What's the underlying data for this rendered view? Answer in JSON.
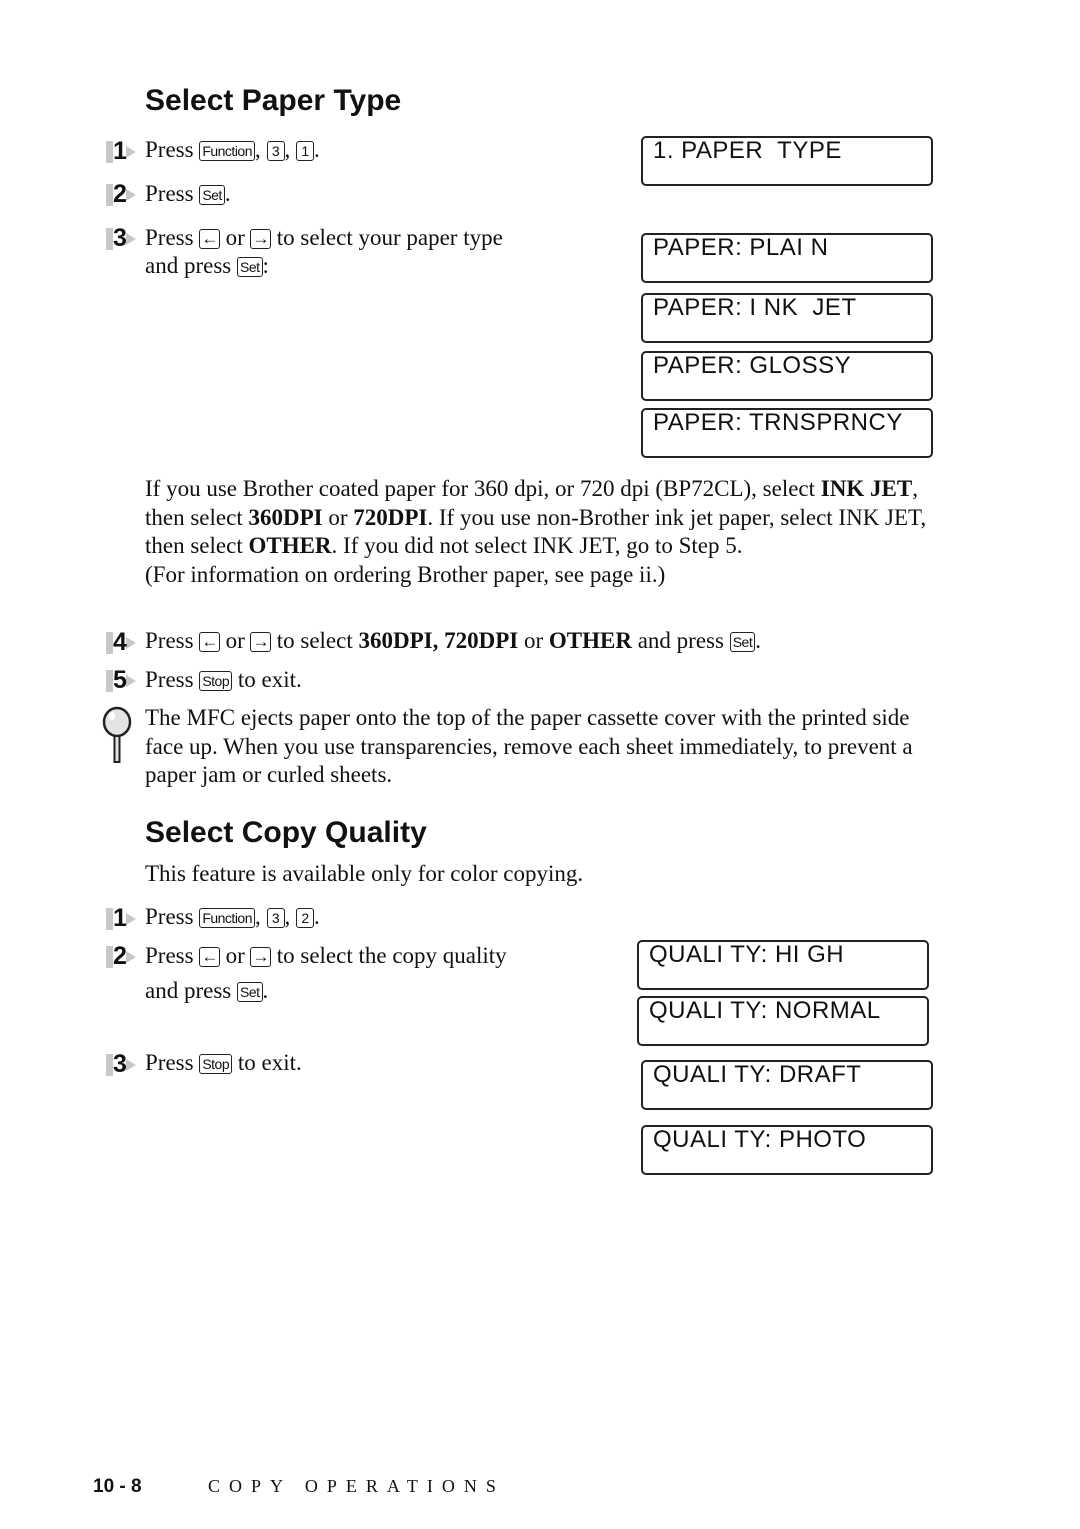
{
  "section1": {
    "title": "Select Paper Type",
    "steps": [
      {
        "num": "1",
        "press": "Press",
        "keys": [
          "Function",
          "3",
          "1"
        ],
        "end": "."
      },
      {
        "num": "2",
        "press": "Press",
        "key": "Set",
        "end": "."
      },
      {
        "num": "3",
        "press": "Press",
        "key_left": "←",
        "or": "or",
        "key_right": "→",
        "text1": "to select your paper type",
        "text2": "and press",
        "key": "Set",
        "end": ":"
      },
      {
        "num": "4",
        "press": "Press",
        "key_left": "←",
        "or": "or",
        "key_right": "→",
        "text_a": "to select",
        "bold_a": "360DPI, 720DPI",
        "text_b": "or",
        "bold_b": "OTHER",
        "text_c": "and press",
        "key": "Set",
        "end": "."
      },
      {
        "num": "5",
        "press": "Press",
        "key": "Stop",
        "end": "to exit."
      }
    ],
    "lcd_menu": "1. PAPER  TYPE",
    "lcd_options": [
      "PAPER: PLAI N",
      "PAPER: I NK  JET",
      "PAPER: GLOSSY",
      "PAPER: TRNSPRNCY"
    ],
    "info": {
      "p1": "If you use Brother coated paper for 360 dpi, or 720 dpi (BP72CL), select",
      "b1": "INK JET",
      "p2": ", then select",
      "b2": "360DPI",
      "p3": "or",
      "b3": "720DPI",
      "p4": ". If you use non-Brother ink jet paper, select INK JET, then select",
      "b4": "OTHER",
      "p5": ". If you did not select INK JET, go to Step 5.",
      "p6": "(For information on ordering Brother paper, see page ii.)"
    },
    "note": "The MFC ejects paper onto the top of the paper cassette cover with the printed side face up. When you use transparencies, remove each sheet immediately, to prevent a paper jam or curled sheets."
  },
  "section2": {
    "title": "Select Copy Quality",
    "intro": "This feature is available only for color copying.",
    "steps": [
      {
        "num": "1",
        "press": "Press",
        "keys": [
          "Function",
          "3",
          "2"
        ],
        "end": "."
      },
      {
        "num": "2",
        "press": "Press",
        "key_left": "←",
        "or": "or",
        "key_right": "→",
        "text1": "to select the copy quality",
        "text2": "and press",
        "key": "Set",
        "end": "."
      },
      {
        "num": "3",
        "press": "Press",
        "key": "Stop",
        "end": "to exit."
      }
    ],
    "lcd_options": [
      "QUALI TY: HI GH",
      "QUALI TY: NORMAL",
      "QUALI TY: DRAFT",
      "QUALI TY: PHOTO"
    ]
  },
  "footer": {
    "page": "10 - 8",
    "section": "COPY OPERATIONS"
  }
}
